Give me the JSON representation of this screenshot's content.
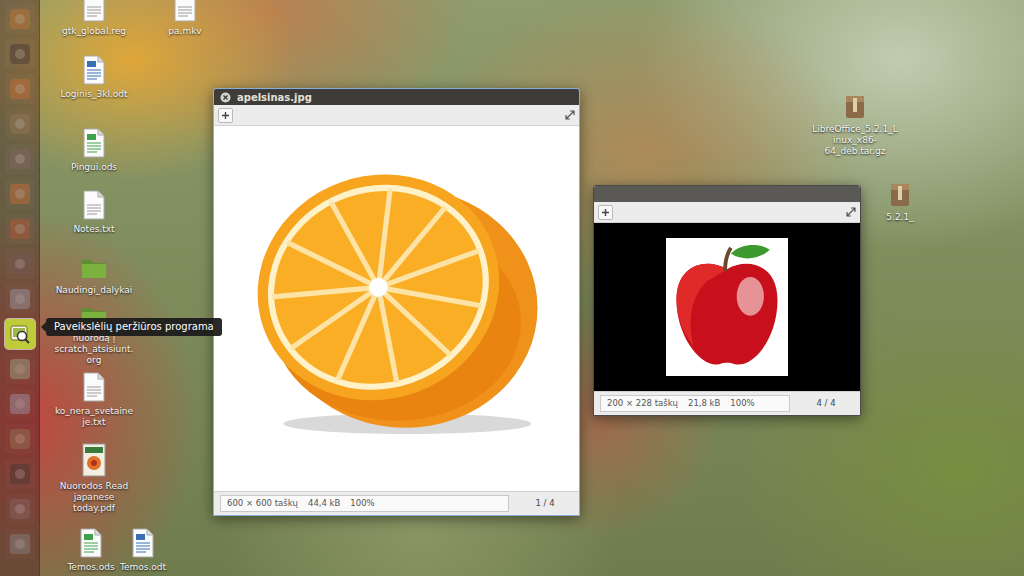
{
  "launcher": {
    "tooltip": "Paveikslėlių peržiūros programa",
    "items": [
      {
        "kind": "dash",
        "selected": false
      },
      {
        "kind": "terminal",
        "selected": false
      },
      {
        "kind": "browser",
        "selected": false
      },
      {
        "kind": "files",
        "selected": false
      },
      {
        "kind": "settings",
        "selected": false
      },
      {
        "kind": "browser",
        "selected": false
      },
      {
        "kind": "store",
        "selected": false
      },
      {
        "kind": "monitor",
        "selected": false
      },
      {
        "kind": "writer",
        "selected": false
      },
      {
        "kind": "viewer",
        "selected": true
      },
      {
        "kind": "calc",
        "selected": false
      },
      {
        "kind": "writer",
        "selected": false
      },
      {
        "kind": "files",
        "selected": false
      },
      {
        "kind": "terminal",
        "selected": false
      },
      {
        "kind": "settings",
        "selected": false
      },
      {
        "kind": "trash",
        "selected": false
      }
    ]
  },
  "desktop": {
    "icons": [
      {
        "label": "gtk_global.reg",
        "kind": "txt"
      },
      {
        "label": "pa.mkv",
        "kind": "txt"
      },
      {
        "label": "Loginis_3kl.odt",
        "kind": "doc"
      },
      {
        "label": "Pingui.ods",
        "kind": "sheet"
      },
      {
        "label": "Notes.txt",
        "kind": "txt"
      },
      {
        "label": "Naudingi_dalykai",
        "kind": "folder"
      },
      {
        "label": "nuorodą į scratch_atsisiunt.org",
        "kind": "folder"
      },
      {
        "label": "ko_nera_svetaineje.txt",
        "kind": "txt"
      },
      {
        "label": "Nuorodos Read japanese today.pdf",
        "kind": "pdf"
      },
      {
        "label": "Temos.ods",
        "kind": "sheet"
      },
      {
        "label": "Temos.odt",
        "kind": "doc"
      },
      {
        "label": "LibreOffice_5.2.1_Linux_x86-64_deb.tar.gz",
        "kind": "archive"
      },
      {
        "label": "5.2.1_",
        "kind": "archive"
      }
    ]
  },
  "windows": [
    {
      "title": "apelsinas.jpg",
      "active": true,
      "picture": "orange",
      "status": {
        "dimensions": "600 × 600 taškų",
        "size": "44,4 kB",
        "zoom": "100%",
        "position": "1 / 4"
      }
    },
    {
      "title": "",
      "active": false,
      "picture": "apple",
      "status": {
        "dimensions": "200 × 228 taškų",
        "size": "21,8 kB",
        "zoom": "100%",
        "position": "4 / 4"
      }
    }
  ]
}
